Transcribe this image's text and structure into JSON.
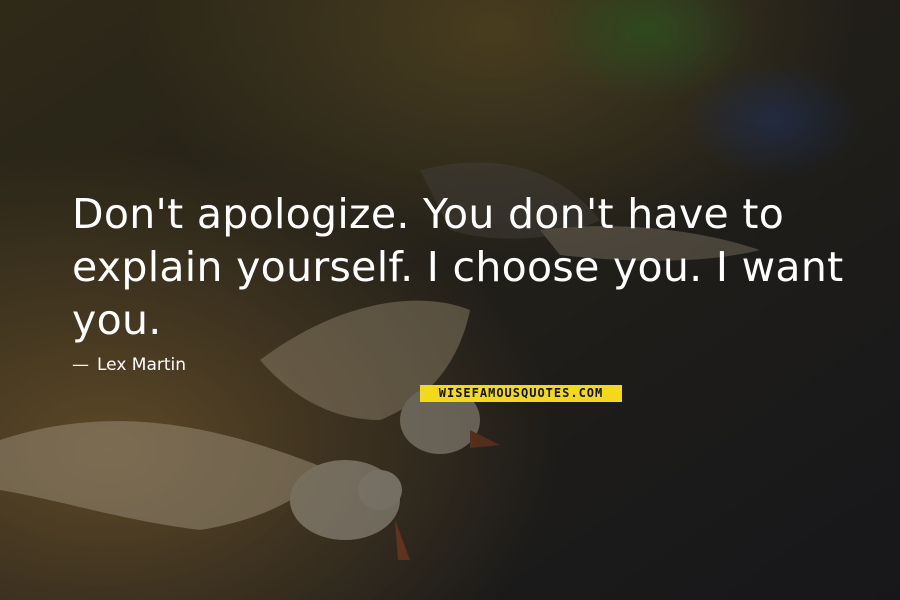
{
  "quote": {
    "text": "Don't apologize. You don't have to explain yourself. I choose you. I want you."
  },
  "author": {
    "dash": "—",
    "name": "Lex Martin"
  },
  "watermark": {
    "text": "WISEFAMOUSQUOTES.COM",
    "color": "#f2d91c"
  }
}
